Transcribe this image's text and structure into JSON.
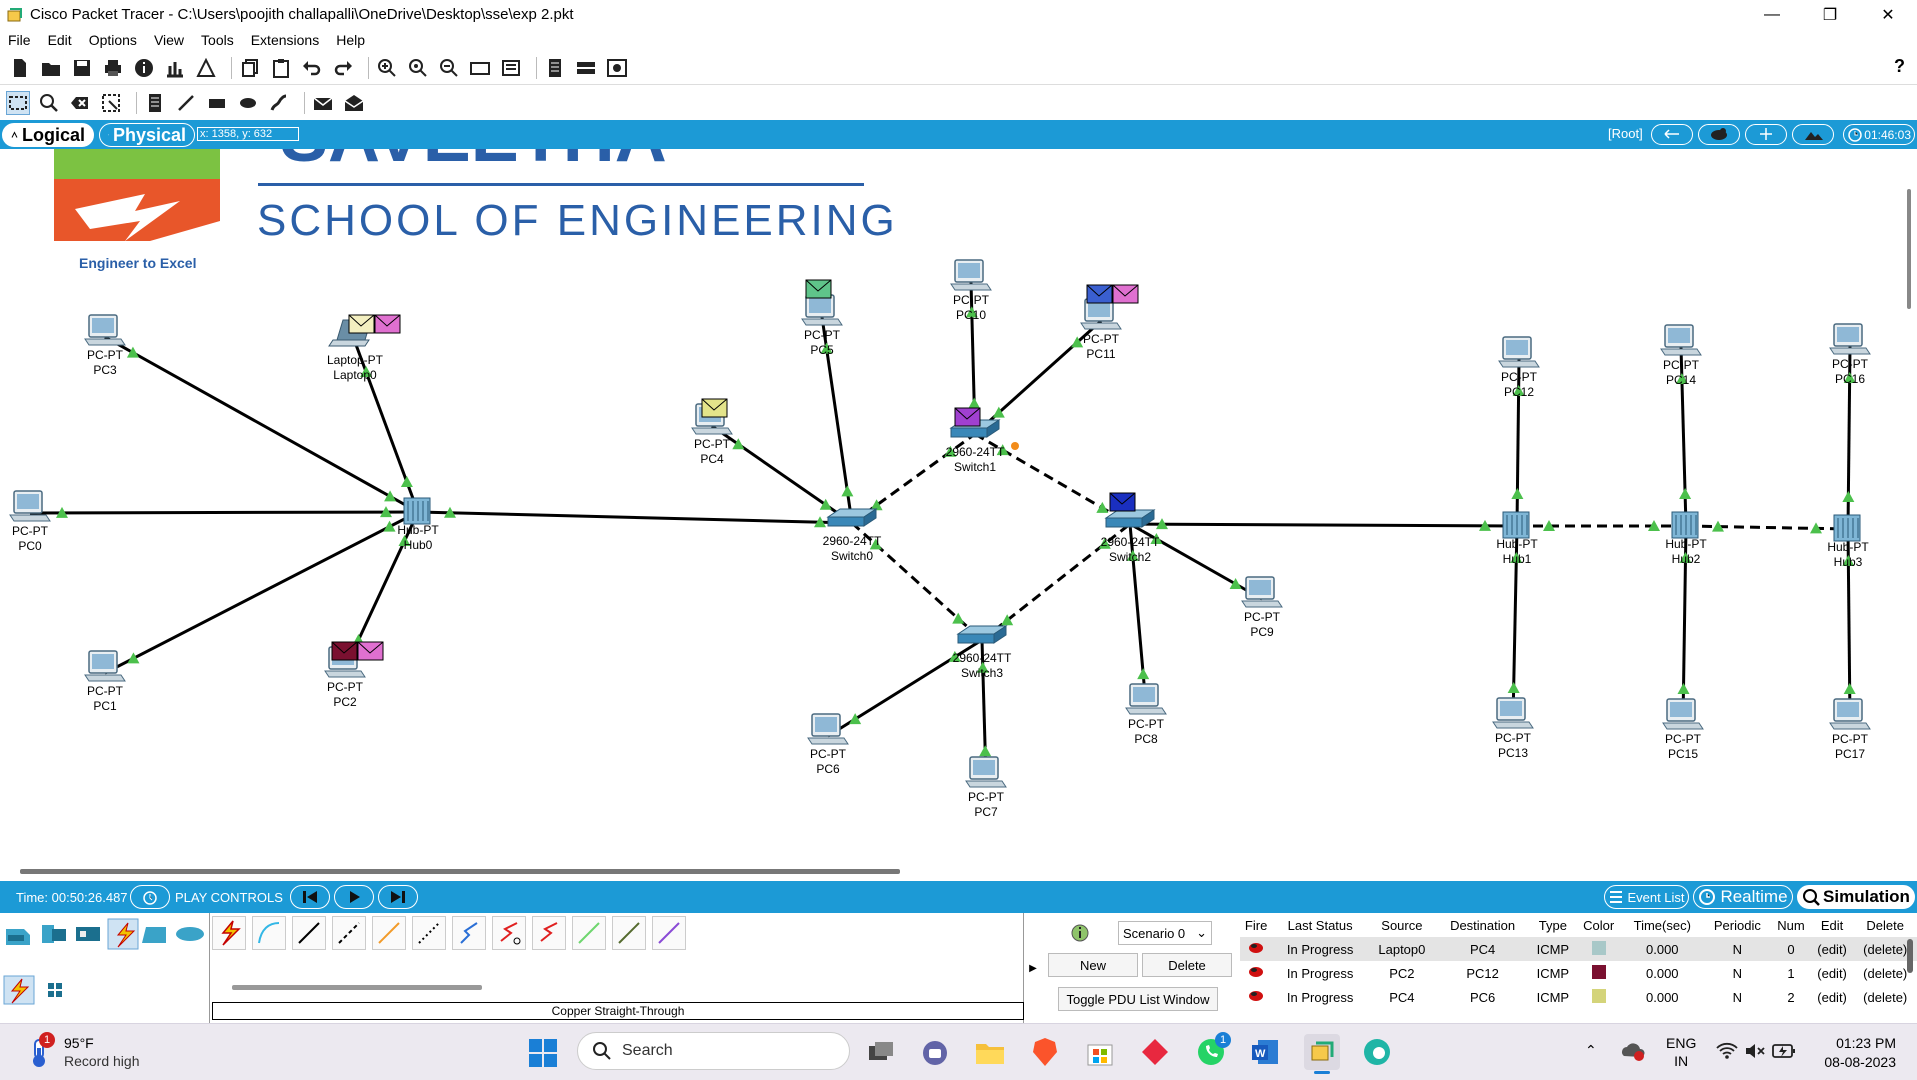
{
  "window": {
    "title": "Cisco Packet Tracer - C:\\Users\\poojith challapalli\\OneDrive\\Desktop\\sse\\exp 2.pkt",
    "minimize": "—",
    "maximize": "❐",
    "close": "✕"
  },
  "menu": [
    "File",
    "Edit",
    "Options",
    "View",
    "Tools",
    "Extensions",
    "Help"
  ],
  "help_label": "?",
  "viewbar": {
    "logical": "Logical",
    "physical": "Physical",
    "coords": "x: 1358, y: 632",
    "root": "[Root]",
    "clock": "01:46:03"
  },
  "logo": {
    "partial_text": "SAVEETHA",
    "school": "SCHOOL OF ENGINEERING",
    "tagline": "Engineer to Excel"
  },
  "devices": [
    {
      "id": "pc3",
      "type": "PC-PT",
      "name": "PC3",
      "kind": "pc"
    },
    {
      "id": "laptop0",
      "type": "Laptop-PT",
      "name": "Laptop0",
      "kind": "laptop"
    },
    {
      "id": "pc0",
      "type": "PC-PT",
      "name": "PC0",
      "kind": "pc"
    },
    {
      "id": "pc1",
      "type": "PC-PT",
      "name": "PC1",
      "kind": "pc"
    },
    {
      "id": "pc2",
      "type": "PC-PT",
      "name": "PC2",
      "kind": "pc"
    },
    {
      "id": "hub0",
      "type": "Hub-PT",
      "name": "Hub0",
      "kind": "hub"
    },
    {
      "id": "pc4",
      "type": "PC-PT",
      "name": "PC4",
      "kind": "pc"
    },
    {
      "id": "pc5",
      "type": "PC-PT",
      "name": "PC5",
      "kind": "pc"
    },
    {
      "id": "pc10",
      "type": "PC-PT",
      "name": "PC10",
      "kind": "pc"
    },
    {
      "id": "pc11",
      "type": "PC-PT",
      "name": "PC11",
      "kind": "pc"
    },
    {
      "id": "switch0",
      "type": "2960-24TT",
      "name": "Switch0",
      "kind": "switch"
    },
    {
      "id": "switch1",
      "type": "2960-24TT",
      "name": "Switch1",
      "kind": "switch"
    },
    {
      "id": "switch2",
      "type": "2960-24TT",
      "name": "Switch2",
      "kind": "switch"
    },
    {
      "id": "switch3",
      "type": "2960-24TT",
      "name": "Switch3",
      "kind": "switch"
    },
    {
      "id": "pc6",
      "type": "PC-PT",
      "name": "PC6",
      "kind": "pc"
    },
    {
      "id": "pc7",
      "type": "PC-PT",
      "name": "PC7",
      "kind": "pc"
    },
    {
      "id": "pc8",
      "type": "PC-PT",
      "name": "PC8",
      "kind": "pc"
    },
    {
      "id": "pc9",
      "type": "PC-PT",
      "name": "PC9",
      "kind": "pc"
    },
    {
      "id": "hub1",
      "type": "Hub-PT",
      "name": "Hub1",
      "kind": "hub"
    },
    {
      "id": "hub2",
      "type": "Hub-PT",
      "name": "Hub2",
      "kind": "hub"
    },
    {
      "id": "hub3",
      "type": "Hub-PT",
      "name": "Hub3",
      "kind": "hub"
    },
    {
      "id": "pc12",
      "type": "PC-PT",
      "name": "PC12",
      "kind": "pc"
    },
    {
      "id": "pc13",
      "type": "PC-PT",
      "name": "PC13",
      "kind": "pc"
    },
    {
      "id": "pc14",
      "type": "PC-PT",
      "name": "PC14",
      "kind": "pc"
    },
    {
      "id": "pc15",
      "type": "PC-PT",
      "name": "PC15",
      "kind": "pc"
    },
    {
      "id": "pc16",
      "type": "PC-PT",
      "name": "PC16",
      "kind": "pc"
    },
    {
      "id": "pc17",
      "type": "PC-PT",
      "name": "PC17",
      "kind": "pc"
    }
  ],
  "links": [
    {
      "a": "pc3",
      "b": "hub0",
      "style": "solid"
    },
    {
      "a": "laptop0",
      "b": "hub0",
      "style": "solid"
    },
    {
      "a": "pc0",
      "b": "hub0",
      "style": "solid"
    },
    {
      "a": "pc1",
      "b": "hub0",
      "style": "solid"
    },
    {
      "a": "pc2",
      "b": "hub0",
      "style": "solid"
    },
    {
      "a": "hub0",
      "b": "switch0",
      "style": "solid"
    },
    {
      "a": "pc4",
      "b": "switch0",
      "style": "solid"
    },
    {
      "a": "pc5",
      "b": "switch0",
      "style": "solid"
    },
    {
      "a": "switch0",
      "b": "switch1",
      "style": "dashed"
    },
    {
      "a": "switch0",
      "b": "switch3",
      "style": "dashed"
    },
    {
      "a": "pc10",
      "b": "switch1",
      "style": "solid"
    },
    {
      "a": "pc11",
      "b": "switch1",
      "style": "solid"
    },
    {
      "a": "switch1",
      "b": "switch2",
      "style": "dashed"
    },
    {
      "a": "switch3",
      "b": "switch2",
      "style": "dashed"
    },
    {
      "a": "pc6",
      "b": "switch3",
      "style": "solid"
    },
    {
      "a": "pc7",
      "b": "switch3",
      "style": "solid"
    },
    {
      "a": "pc8",
      "b": "switch2",
      "style": "solid"
    },
    {
      "a": "pc9",
      "b": "switch2",
      "style": "solid"
    },
    {
      "a": "switch2",
      "b": "hub1",
      "style": "solid"
    },
    {
      "a": "hub1",
      "b": "hub2",
      "style": "dashed"
    },
    {
      "a": "hub2",
      "b": "hub3",
      "style": "dashed"
    },
    {
      "a": "pc12",
      "b": "hub1",
      "style": "solid"
    },
    {
      "a": "pc13",
      "b": "hub1",
      "style": "solid"
    },
    {
      "a": "pc14",
      "b": "hub2",
      "style": "solid"
    },
    {
      "a": "pc15",
      "b": "hub2",
      "style": "solid"
    },
    {
      "a": "pc16",
      "b": "hub3",
      "style": "solid"
    },
    {
      "a": "pc17",
      "b": "hub3",
      "style": "solid"
    }
  ],
  "envelopes": [
    {
      "at": "laptop0",
      "colors": [
        "#f3efc0",
        "#e070d0"
      ]
    },
    {
      "at": "pc4",
      "colors": [
        "#e4e48a"
      ]
    },
    {
      "at": "pc5",
      "colors": [
        "#5fc48a"
      ]
    },
    {
      "at": "pc11",
      "colors": [
        "#3a5fd0",
        "#e070d0"
      ]
    },
    {
      "at": "switch1",
      "colors": [
        "#a040d0"
      ]
    },
    {
      "at": "switch2",
      "colors": [
        "#1a2fc0"
      ]
    },
    {
      "at": "pc2",
      "colors": [
        "#7a1030",
        "#e070d0"
      ]
    }
  ],
  "colors": {
    "link_up": "#4cc04c",
    "accent": "#1c9ad6",
    "logo_orange": "#e8562a",
    "logo_blue": "#2a5fa8",
    "logo_green": "#7cc242"
  },
  "statusbar": {
    "time": "Time: 00:50:26.487",
    "play_controls": "PLAY CONTROLS",
    "event_list": "Event List",
    "realtime": "Realtime",
    "simulation": "Simulation"
  },
  "connection_label": "Copper Straight-Through",
  "scenario": {
    "selected": "Scenario 0",
    "new_label": "New",
    "delete_label": "Delete",
    "toggle_label": "Toggle PDU List Window"
  },
  "pdu_table": {
    "headers": [
      "Fire",
      "Last Status",
      "Source",
      "Destination",
      "Type",
      "Color",
      "Time(sec)",
      "Periodic",
      "Num",
      "Edit",
      "Delete"
    ],
    "rows": [
      {
        "status": "In Progress",
        "source": "Laptop0",
        "dest": "PC4",
        "type": "ICMP",
        "color": "#a8c8c8",
        "time": "0.000",
        "periodic": "N",
        "num": "0",
        "edit": "(edit)",
        "delete": "(delete)"
      },
      {
        "status": "In Progress",
        "source": "PC2",
        "dest": "PC12",
        "type": "ICMP",
        "color": "#7a1030",
        "time": "0.000",
        "periodic": "N",
        "num": "1",
        "edit": "(edit)",
        "delete": "(delete)"
      },
      {
        "status": "In Progress",
        "source": "PC4",
        "dest": "PC6",
        "type": "ICMP",
        "color": "#d4d47a",
        "time": "0.000",
        "periodic": "N",
        "num": "2",
        "edit": "(edit)",
        "delete": "(delete)"
      }
    ]
  },
  "taskbar": {
    "temp": "95°F",
    "weather": "Record high",
    "weather_badge": "1",
    "search": "Search",
    "lang1": "ENG",
    "lang2": "IN",
    "time": "01:23 PM",
    "date": "08-08-2023",
    "whatsapp_badge": "1"
  }
}
